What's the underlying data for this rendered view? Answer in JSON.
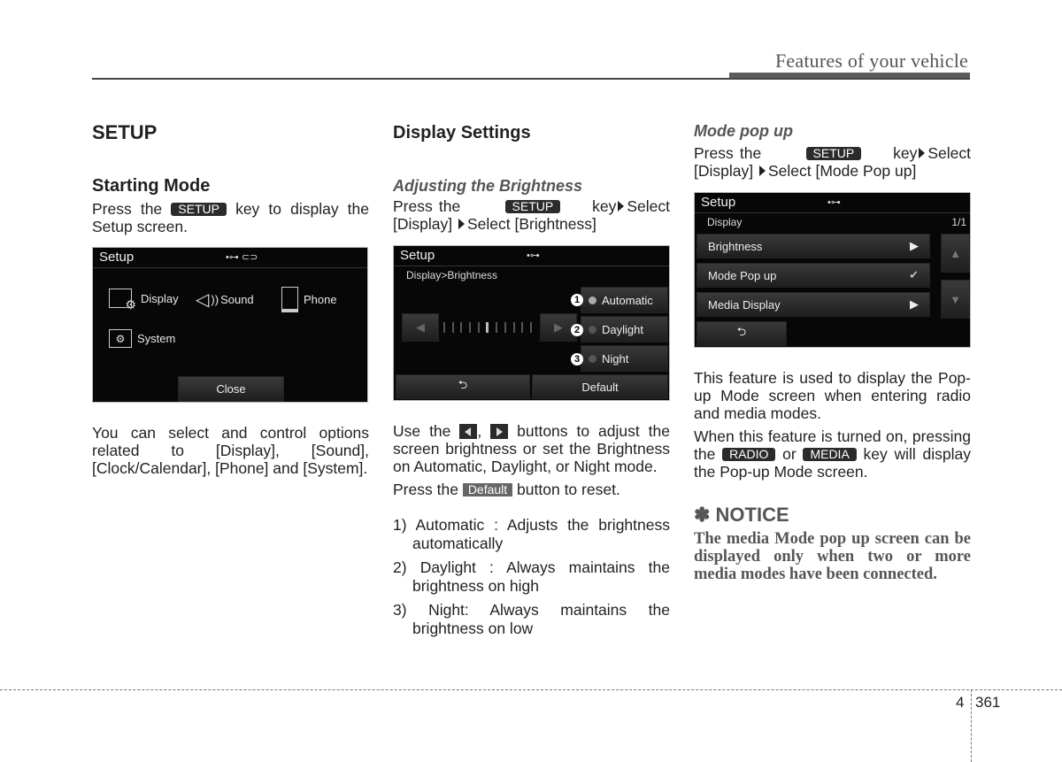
{
  "header": {
    "title": "Features of your vehicle"
  },
  "col1": {
    "heading": "SETUP",
    "subheading": "Starting Mode",
    "p1_before": "Press the",
    "key_setup": "SETUP",
    "p1_after": "key to display the Setup screen.",
    "screen": {
      "title": "Setup",
      "items": [
        {
          "label": "Display",
          "icon": "display-gear-icon"
        },
        {
          "label": "Sound",
          "icon": "speaker-icon"
        },
        {
          "label": "Phone",
          "icon": "phone-icon"
        },
        {
          "label": "System",
          "icon": "folder-gear-icon"
        }
      ],
      "close_label": "Close"
    },
    "p2": "You can select and control options related to [Display], [Sound], [Clock/Calendar], [Phone] and [System]."
  },
  "col2": {
    "heading": "Display Settings",
    "subheading": "Adjusting the Brightness",
    "p1_a": "Press the",
    "key_setup": "SETUP",
    "p1_b": "key",
    "p1_c": "Select [Display]",
    "p1_d": "Select [Brightness]",
    "screen": {
      "title": "Setup",
      "breadcrumb": "Display>Brightness",
      "options": [
        {
          "num": "1",
          "label": "Automatic"
        },
        {
          "num": "2",
          "label": "Daylight"
        },
        {
          "num": "3",
          "label": "Night"
        }
      ],
      "default_label": "Default",
      "slider_level": 0.5
    },
    "p2_a": "Use the",
    "p2_b": ",",
    "p2_c": "buttons to adjust the screen brightness or set the Brightness on Automatic, Daylight, or Night mode.",
    "p3_a": "Press the",
    "key_default": "Default",
    "p3_b": "button to reset.",
    "list": [
      "1) Automatic : Adjusts the brightness automatically",
      "2) Daylight : Always maintains the brightness on high",
      "3) Night: Always maintains the brightness on low"
    ]
  },
  "col3": {
    "subheading": "Mode pop up",
    "p1_a": "Press the",
    "key_setup": "SETUP",
    "p1_b": "key",
    "p1_c": "Select [Display]",
    "p1_d": "Select [Mode Pop up]",
    "screen": {
      "title": "Setup",
      "section": "Display",
      "page": "1/1",
      "rows": [
        {
          "label": "Brightness",
          "control": "arrow"
        },
        {
          "label": "Mode Pop up",
          "control": "check"
        },
        {
          "label": "Media Display",
          "control": "arrow"
        }
      ]
    },
    "p2": "This feature is used to display the Pop-up Mode screen when entering radio and media modes.",
    "p3_a": "When this feature is turned on, pressing the",
    "key_radio": "RADIO",
    "p3_b": "or",
    "key_media": "MEDIA",
    "p3_c": "key will display the Pop-up Mode screen.",
    "notice_heading": "✽ NOTICE",
    "notice_text": "The media Mode pop up screen can be displayed only when two or more media modes have been connected."
  },
  "footer": {
    "chapter": "4",
    "page": "361"
  }
}
